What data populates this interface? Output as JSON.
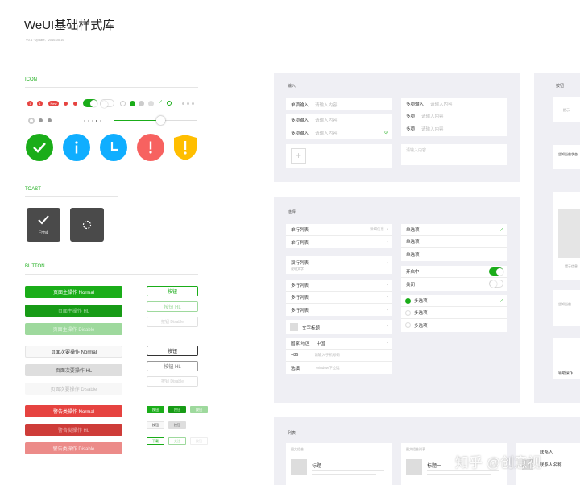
{
  "header": {
    "title": "WeUI基础样式库",
    "subtitle": "V0.4 ·Update：2016.05.16"
  },
  "icon_section": {
    "title": "ICON",
    "badges": [
      "1",
      "1",
      "New"
    ]
  },
  "toast_section": {
    "title": "TOAST",
    "toast_done": "已完成"
  },
  "button_section": {
    "title": "BUTTON",
    "primary": [
      "页面主操作 Normal",
      "页面主操作 HL",
      "页面主操作 Disable"
    ],
    "secondary": [
      "页面次要操作 Normal",
      "页面次要操作 HL",
      "页面次要操作 Disable"
    ],
    "warn": [
      "警告类操作 Normal",
      "警告类操作 HL",
      "警告类操作 Disable"
    ],
    "plain_green": [
      "按钮",
      "按钮 HL",
      "按钮 Disable"
    ],
    "plain_default": [
      "按钮",
      "按钮 HL",
      "按钮 Disable"
    ],
    "mini_row1": [
      "按钮",
      "按钮",
      "按钮"
    ],
    "mini_row2": [
      "按钮",
      "按钮"
    ],
    "mini_row3": [
      "下载",
      "关注",
      "按钮"
    ]
  },
  "input_panel": {
    "title": "输入",
    "left": [
      {
        "label": "单项输入",
        "ph": "请输入内容"
      },
      {
        "label": "多项输入",
        "ph": "请输入内容"
      },
      {
        "label": "多项输入",
        "ph": "请输入内容"
      }
    ],
    "right": [
      {
        "label": "多项输入",
        "ph": "请输入内容"
      },
      {
        "label": "多项",
        "ph": "请输入内容"
      },
      {
        "label": "多项",
        "ph": "请输入内容"
      }
    ],
    "textarea_ph": "请输入内容"
  },
  "select_panel": {
    "title": "选择",
    "list": [
      {
        "label": "单行列表",
        "detail": "详细信息"
      },
      {
        "label": "单行列表"
      },
      {
        "label": "双行列表",
        "sub": "说明文字"
      },
      {
        "label": "多行列表"
      },
      {
        "label": "多行列表"
      },
      {
        "label": "多行列表"
      }
    ],
    "img_row": "文字标题",
    "form": [
      {
        "label": "国家/地区",
        "value": "中国"
      },
      {
        "label": "+86",
        "value": "请输入手机号码"
      },
      {
        "label": "选填",
        "value": "Window下拉选"
      }
    ],
    "radios": [
      "单选项",
      "单选项",
      "单选项"
    ],
    "switches": [
      "开启中",
      "关闭"
    ],
    "checks": [
      "多选项",
      "多选项",
      "多选项"
    ]
  },
  "list_panel": {
    "title": "列表",
    "card1_head": "图文组合",
    "card1_title": "标题",
    "card2_head": "图文组合列表",
    "card2_title": "标题一",
    "card3_text": "联系人",
    "card3_sub": "联系人名称"
  },
  "right_panel": {
    "title": "按钮",
    "texts": [
      "告知当前状态",
      "提示信息",
      "辅助操作"
    ]
  },
  "watermark": "知乎 @创意视",
  "colors": {
    "green": "#1aad19",
    "red": "#e64340",
    "blue": "#10aeff",
    "yellow": "#ffbe00"
  }
}
